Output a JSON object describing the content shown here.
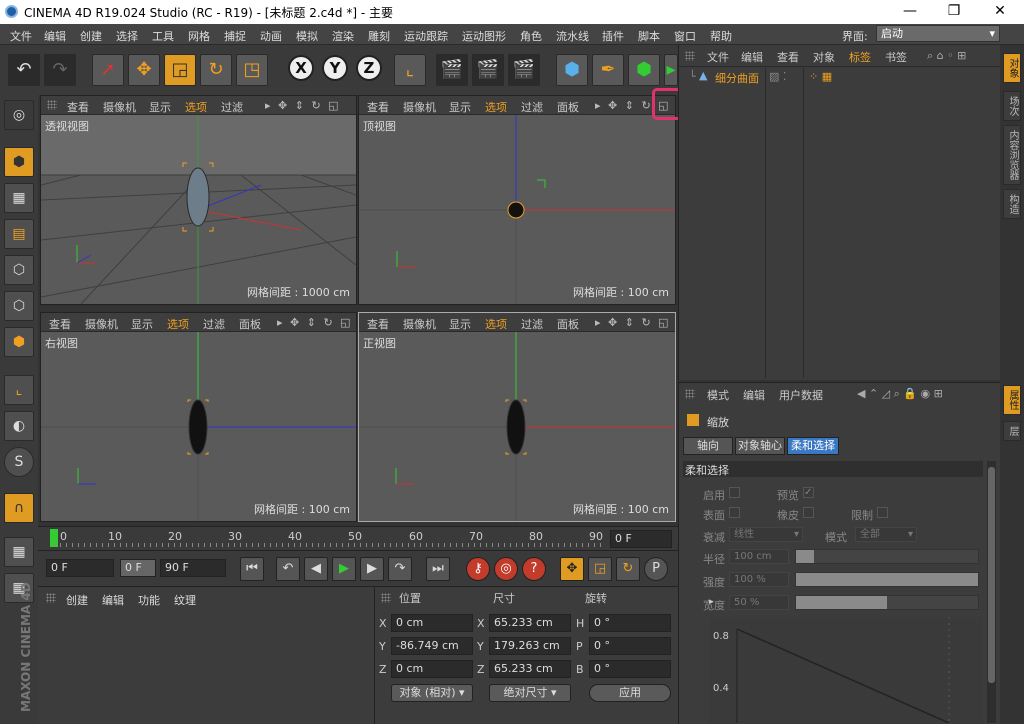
{
  "window": {
    "title": "CINEMA 4D R19.024 Studio (RC - R19) - [未标题 2.c4d *] - 主要",
    "controls": {
      "minimize": "—",
      "maximize": "❐",
      "close": "✕"
    }
  },
  "menubar": {
    "items": [
      "文件",
      "编辑",
      "创建",
      "选择",
      "工具",
      "网格",
      "捕捉",
      "动画",
      "模拟",
      "渲染",
      "雕刻",
      "运动跟踪",
      "运动图形",
      "角色",
      "流水线",
      "插件",
      "脚本",
      "窗口",
      "帮助"
    ],
    "layout_label": "界面:",
    "layout_value": "启动"
  },
  "toolbar": {
    "x": "X",
    "y": "Y",
    "z": "Z"
  },
  "viewport_menu": [
    "查看",
    "摄像机",
    "显示",
    "选项",
    "过滤",
    "面板"
  ],
  "viewports": {
    "perspective": {
      "title": "透视视图",
      "grid": "网格间距 : 1000 cm"
    },
    "top": {
      "title": "顶视图",
      "grid": "网格间距 : 100 cm"
    },
    "right": {
      "title": "右视图",
      "grid": "网格间距 : 100 cm"
    },
    "front": {
      "title": "正视图",
      "grid": "网格间距 : 100 cm"
    }
  },
  "timeline": {
    "ticks": [
      "0",
      "10",
      "20",
      "30",
      "40",
      "50",
      "60",
      "70",
      "80",
      "90"
    ],
    "current_frame": "0 F",
    "start_frame": "0 F",
    "step": "0 F",
    "end_frame": "90 F"
  },
  "material_panel": {
    "menu": [
      "创建",
      "编辑",
      "功能",
      "纹理"
    ]
  },
  "coord_panel": {
    "headers": {
      "position": "位置",
      "size": "尺寸",
      "rotation": "旋转"
    },
    "pos": {
      "x_label": "X",
      "x": "0 cm",
      "y_label": "Y",
      "y": "-86.749 cm",
      "z_label": "Z",
      "z": "0 cm"
    },
    "size": {
      "x_label": "X",
      "x": "65.233 cm",
      "y_label": "Y",
      "y": "179.263 cm",
      "z_label": "Z",
      "z": "65.233 cm"
    },
    "rot": {
      "h_label": "H",
      "h": "0 °",
      "p_label": "P",
      "p": "0 °",
      "b_label": "B",
      "b": "0 °"
    },
    "mode_dropdown": "对象 (相对)",
    "size_dropdown": "绝对尺寸",
    "apply_button": "应用"
  },
  "object_panel": {
    "menu": [
      "文件",
      "编辑",
      "查看",
      "对象",
      "标签",
      "书签"
    ],
    "object_name": "细分曲面"
  },
  "right_tabs": {
    "objects": "对象",
    "takes": "场次",
    "content_browser": "内容浏览器",
    "structure": "构造",
    "attributes": "属性",
    "layers": "层"
  },
  "attributes_panel": {
    "menu": [
      "模式",
      "编辑",
      "用户数据"
    ],
    "object_label": "缩放",
    "tabs": [
      "轴向",
      "对象轴心",
      "柔和选择"
    ],
    "section_title": "柔和选择",
    "labels": {
      "enable": "启用",
      "preview": "预览",
      "preview_check": "✓",
      "surface": "表面",
      "rubber": "橡皮",
      "restrict": "限制",
      "falloff": "衰减",
      "falloff_value": "线性",
      "mode": "模式",
      "mode_value": "全部",
      "radius": "半径",
      "radius_value": "100 cm",
      "strength": "强度",
      "strength_value": "100 %",
      "width": "宽度",
      "width_value": "50 %"
    },
    "sliders": {
      "strength": 1.0,
      "width": 0.5
    },
    "graph_labels": {
      "y1": "0.8",
      "y2": "0.4"
    }
  }
}
